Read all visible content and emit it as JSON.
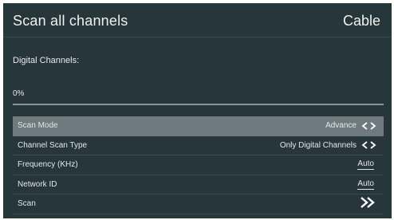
{
  "header": {
    "title": "Scan all channels",
    "source": "Cable"
  },
  "status": {
    "digital_label": "Digital Channels:",
    "progress_text": "0%",
    "progress": 0
  },
  "menu": {
    "items": [
      {
        "label": "Scan Mode",
        "value": "Advance"
      },
      {
        "label": "Channel Scan Type",
        "value": "Only Digital Channels"
      },
      {
        "label": "Frequency (KHz)",
        "value": "Auto"
      },
      {
        "label": "Network ID",
        "value": "Auto"
      },
      {
        "label": "Scan"
      }
    ]
  },
  "icons": {
    "left_right": "left-right-arrows-icon",
    "go": "double-chevron-right-icon"
  },
  "colors": {
    "background": "#27363a",
    "selected_row": "#6e7a7e",
    "text": "#e9ecec"
  }
}
